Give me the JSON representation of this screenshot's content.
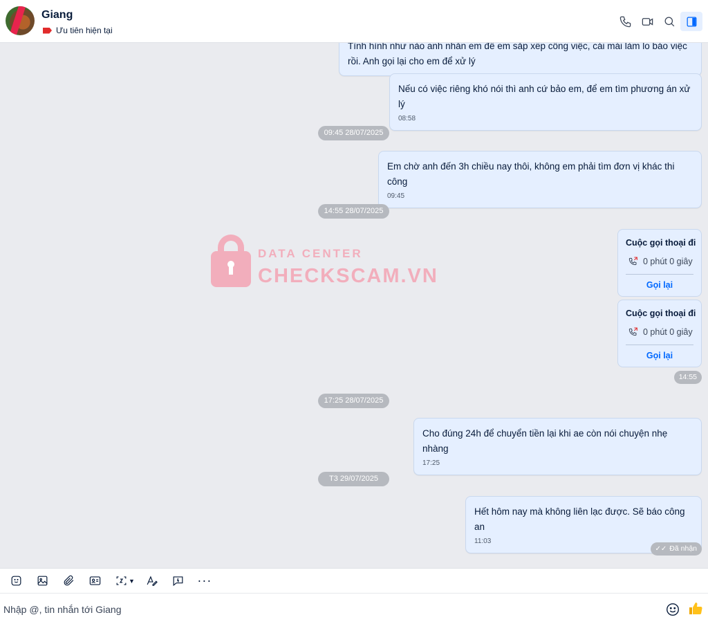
{
  "header": {
    "contact_name": "Giang",
    "tag_label": "Ưu tiên hiện tại",
    "icons": [
      "phone-icon",
      "video-call-icon",
      "search-icon",
      "toggle-sidebar-icon"
    ]
  },
  "watermark": {
    "line1": "DATA CENTER",
    "line2": "CHECKSCAM.VN"
  },
  "messages": {
    "m1": {
      "text": "Tình hình như nào anh nhắn em để em sắp xếp công việc, cái mái làm lo báo việc rồi. Anh gọi lại cho em để xử lý"
    },
    "m2": {
      "text": "Nếu có việc riêng khó nói thì anh cứ bảo em, để em tìm phương án xử lý",
      "time": "08:58"
    },
    "d1": "09:45 28/07/2025",
    "m3": {
      "text": "Em chờ anh đến 3h chiều nay thôi, không em phải tìm đơn vị khác thi công",
      "time": "09:45"
    },
    "d2": "14:55 28/07/2025",
    "call1": {
      "title": "Cuộc gọi thoại đi",
      "duration": "0 phút 0 giây",
      "callback": "Gọi lại"
    },
    "call2": {
      "title": "Cuộc gọi thoại đi",
      "duration": "0 phút 0 giây",
      "callback": "Gọi lại"
    },
    "call_time": "14:55",
    "d3": "17:25 28/07/2025",
    "m4": {
      "text": "Cho đúng 24h để chuyển tiền lại khi ae còn nói chuyện nhẹ nhàng",
      "time": "17:25"
    },
    "d4": "T3 29/07/2025",
    "m5": {
      "text": "Hết hôm nay mà không liên lạc được. Sẽ báo công an",
      "time": "11:03"
    },
    "status": "Đã nhận"
  },
  "composer": {
    "placeholder": "Nhập @, tin nhắn tới Giang",
    "toolbar_icons": [
      "sticker-icon",
      "image-icon",
      "attachment-icon",
      "contact-card-icon",
      "screenshot-icon",
      "text-format-icon",
      "quick-message-icon",
      "more-icon"
    ],
    "more_label": "···",
    "send_icon": "thumbs-up-icon",
    "emoji_icon": "emoji-icon"
  },
  "colors": {
    "accent": "#0068ff",
    "bubble": "#e5efff",
    "background": "#eaebef",
    "tag": "#e12b2b"
  }
}
